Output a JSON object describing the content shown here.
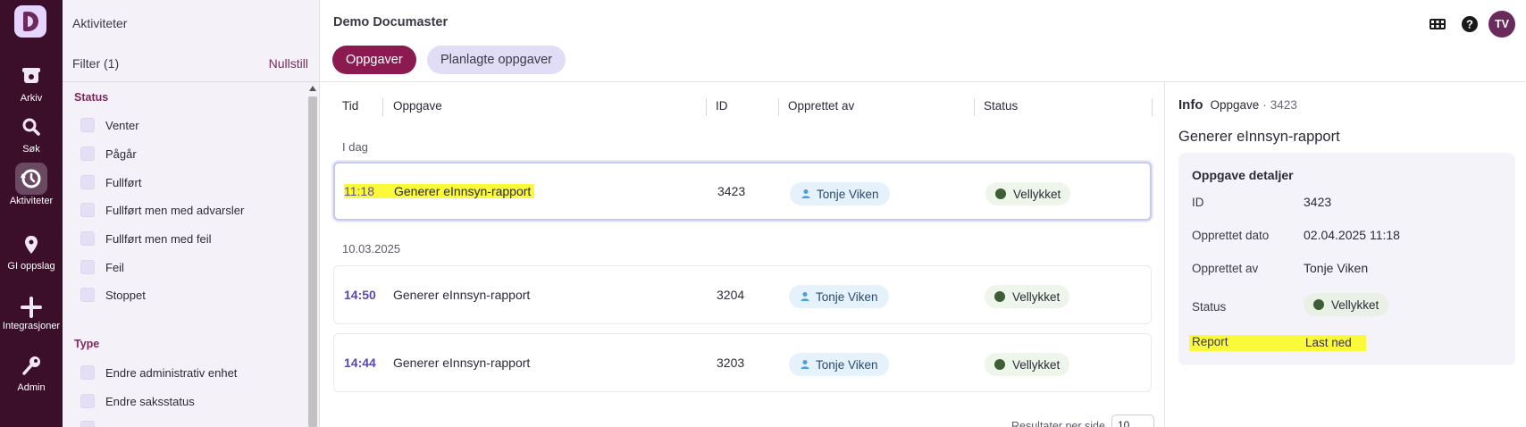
{
  "rail": {
    "items": [
      {
        "label": "Arkiv",
        "icon": "archive-icon"
      },
      {
        "label": "Søk",
        "icon": "search-icon"
      },
      {
        "label": "Aktiviteter",
        "icon": "activity-icon"
      },
      {
        "label": "GI oppslag",
        "icon": "location-pin-icon"
      },
      {
        "label": "Integrasjoner",
        "icon": "plus-icon"
      },
      {
        "label": "Admin",
        "icon": "key-icon"
      }
    ],
    "active": "Aktiviteter"
  },
  "filter": {
    "title": "Aktiviteter",
    "header": "Filter (1)",
    "reset": "Nullstill",
    "status_heading": "Status",
    "status_options": [
      "Venter",
      "Pågår",
      "Fullført",
      "Fullført men med advarsler",
      "Fullført men med feil",
      "Feil",
      "Stoppet"
    ],
    "type_heading": "Type",
    "type_options": [
      "Endre administrativ enhet",
      "Endre saksstatus"
    ]
  },
  "header": {
    "title": "Demo Documaster",
    "tabs": [
      "Oppgaver",
      "Planlagte oppgaver"
    ],
    "active_tab": "Oppgaver",
    "avatar": "TV"
  },
  "table": {
    "columns": [
      "Tid",
      "Oppgave",
      "ID",
      "Opprettet av",
      "Status"
    ],
    "groups": [
      {
        "label": "I dag",
        "rows": [
          {
            "time": "11:18",
            "task": "Generer eInnsyn-rapport",
            "id": "3423",
            "created_by": "Tonje Viken",
            "status": "Vellykket",
            "selected": true
          }
        ]
      },
      {
        "label": "10.03.2025",
        "rows": [
          {
            "time": "14:50",
            "task": "Generer eInnsyn-rapport",
            "id": "3204",
            "created_by": "Tonje Viken",
            "status": "Vellykket"
          },
          {
            "time": "14:44",
            "task": "Generer eInnsyn-rapport",
            "id": "3203",
            "created_by": "Tonje Viken",
            "status": "Vellykket"
          }
        ]
      }
    ],
    "pager_label": "Resultater per side",
    "pager_value": "10"
  },
  "info": {
    "label": "Info",
    "type": "Oppgave",
    "separator": "·",
    "id": "3423",
    "title": "Generer eInnsyn-rapport",
    "card_title": "Oppgave detaljer",
    "fields": {
      "id_label": "ID",
      "id_value": "3423",
      "created_date_label": "Opprettet dato",
      "created_date_value": "02.04.2025 11:18",
      "created_by_label": "Opprettet av",
      "created_by_value": "Tonje Viken",
      "status_label": "Status",
      "status_value": "Vellykket",
      "report_label": "Report",
      "report_link": "Last ned"
    }
  },
  "colors": {
    "rail": "#3b0f2a",
    "accent": "#8a1a4f",
    "highlight": "#fafa3a",
    "success_dot": "#3e5e36"
  }
}
